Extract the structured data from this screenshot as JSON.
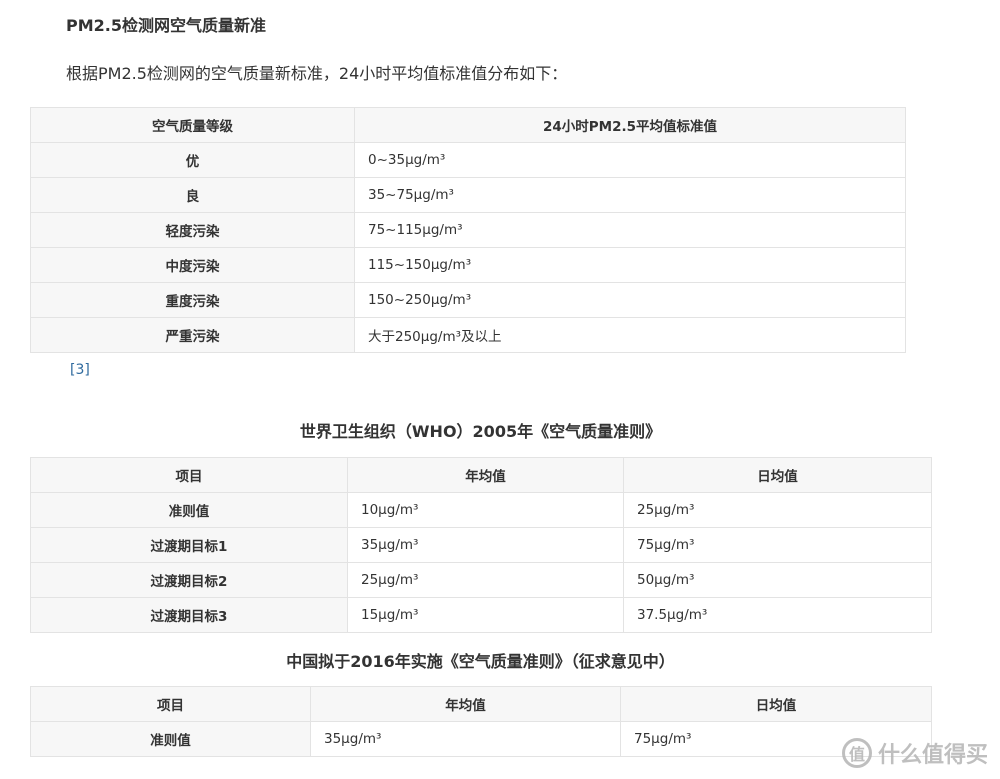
{
  "section": {
    "title": "PM2.5检测网空气质量新准",
    "intro": "根据PM2.5检测网的空气质量新标准，24小时平均值标准值分布如下："
  },
  "table1": {
    "headers": [
      "空气质量等级",
      "24小时PM2.5平均值标准值"
    ],
    "rows": [
      [
        "优",
        "0~35μg/m³"
      ],
      [
        "良",
        "35~75μg/m³"
      ],
      [
        "轻度污染",
        "75~115μg/m³"
      ],
      [
        "中度污染",
        "115~150μg/m³"
      ],
      [
        "重度污染",
        "150~250μg/m³"
      ],
      [
        "严重污染",
        "大于250μg/m³及以上"
      ]
    ],
    "reference": "[3]"
  },
  "table2": {
    "title": "世界卫生组织（WHO）2005年《空气质量准则》",
    "headers": [
      "项目",
      "年均值",
      "日均值"
    ],
    "rows": [
      [
        "准则值",
        "10μg/m³",
        "25μg/m³"
      ],
      [
        "过渡期目标1",
        "35μg/m³",
        "75μg/m³"
      ],
      [
        "过渡期目标2",
        "25μg/m³",
        "50μg/m³"
      ],
      [
        "过渡期目标3",
        "15μg/m³",
        "37.5μg/m³"
      ]
    ]
  },
  "table3": {
    "title": "中国拟于2016年实施《空气质量准则》（征求意见中）",
    "headers": [
      "项目",
      "年均值",
      "日均值"
    ],
    "rows": [
      [
        "准则值",
        "35μg/m³",
        "75μg/m³"
      ]
    ]
  },
  "watermark": {
    "logo_glyph": "值",
    "text": "什么值得买"
  }
}
